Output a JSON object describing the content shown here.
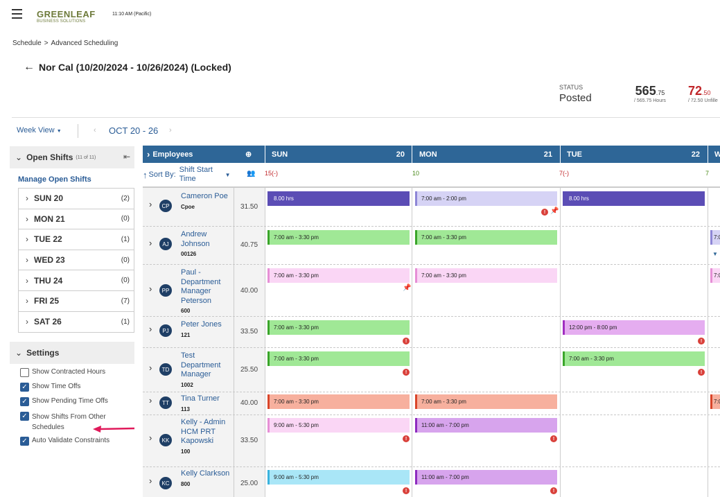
{
  "header": {
    "logo_main": "GREENLEAF",
    "logo_sub": "BUSINESS SOLUTIONS",
    "clock": "11:10 AM (Pacific)"
  },
  "breadcrumb": [
    "Schedule",
    ">",
    "Advanced Scheduling"
  ],
  "page_title": "Nor Cal (10/20/2024 - 10/26/2024) (Locked)",
  "status": {
    "label": "STATUS",
    "value": "Posted",
    "hours_main": "565",
    "hours_dec": ".75",
    "hours_sub": "/ 565.75 Hours",
    "unfilled_main": "72",
    "unfilled_dec": ".50",
    "unfilled_sub": "/ 72.50 Unfille"
  },
  "toolbar": {
    "week_view": "Week View",
    "date_range": "OCT 20 - 26"
  },
  "open_shifts": {
    "title": "Open Shifts",
    "count": "(11 of 11)",
    "manage_link": "Manage Open Shifts",
    "days": [
      {
        "label": "SUN 20",
        "count": "(2)"
      },
      {
        "label": "MON 21",
        "count": "(0)"
      },
      {
        "label": "TUE 22",
        "count": "(1)"
      },
      {
        "label": "WED 23",
        "count": "(0)"
      },
      {
        "label": "THU 24",
        "count": "(0)"
      },
      {
        "label": "FRI 25",
        "count": "(7)"
      },
      {
        "label": "SAT 26",
        "count": "(1)"
      }
    ]
  },
  "settings": {
    "title": "Settings",
    "items": [
      {
        "label": "Show Contracted Hours",
        "checked": false
      },
      {
        "label": "Show Time Offs",
        "checked": true
      },
      {
        "label": "Show Pending Time Offs",
        "checked": true
      },
      {
        "label": "Show Shifts From Other Schedules",
        "checked": true
      },
      {
        "label": "Auto Validate Constraints",
        "checked": true
      }
    ]
  },
  "grid": {
    "employees_label": "Employees",
    "sort_by": "Sort By:",
    "sort_field": "Shift Start Time",
    "days": [
      {
        "name": "SUN",
        "num": "20",
        "count": "15(-)",
        "count_color": "#c0262a"
      },
      {
        "name": "MON",
        "num": "21",
        "count": "10",
        "count_color": "#4a8a1a"
      },
      {
        "name": "TUE",
        "num": "22",
        "count": "7(-)",
        "count_color": "#c0262a"
      },
      {
        "name": "W",
        "num": "",
        "count": "7",
        "count_color": "#4a8a1a"
      }
    ]
  },
  "employees": [
    {
      "initials": "CP",
      "name": "Cameron Poe",
      "id": "Cpoe",
      "hours": "31.50"
    },
    {
      "initials": "AJ",
      "name": "Andrew Johnson",
      "id": "00126",
      "hours": "40.75"
    },
    {
      "initials": "PP",
      "name": "Paul - Department Manager Peterson",
      "id": "600",
      "hours": "40.00"
    },
    {
      "initials": "PJ",
      "name": "Peter Jones",
      "id": "121",
      "hours": "33.50"
    },
    {
      "initials": "TD",
      "name": "Test Department Manager",
      "id": "1002",
      "hours": "25.50"
    },
    {
      "initials": "TT",
      "name": "Tina Turner",
      "id": "113",
      "hours": "40.00"
    },
    {
      "initials": "KK",
      "name": "Kelly - Admin HCM PRT Kapowski",
      "id": "100",
      "hours": "33.50"
    },
    {
      "initials": "KC",
      "name": "Kelly Clarkson",
      "id": "800",
      "hours": "25.00"
    }
  ],
  "shifts": [
    {
      "label": "8.00 hrs",
      "bg": "#5b4db5",
      "border": "#5b4db5",
      "color": "#fff"
    },
    {
      "label": "7:00 am - 2:00 pm",
      "bg": "#d6d3f5",
      "border": "#8e86d6",
      "color": "#222"
    },
    {
      "label": "8.00 hrs",
      "bg": "#5b4db5",
      "border": "#5b4db5",
      "color": "#fff"
    },
    {
      "label": "7:00 am - 3:30 pm",
      "bg": "#a0e896",
      "border": "#3aa52a",
      "color": "#222"
    },
    {
      "label": "7:00 am - 3:30 pm",
      "bg": "#a0e896",
      "border": "#3aa52a",
      "color": "#222"
    },
    {
      "label": "7:0",
      "bg": "#d6d3f5",
      "border": "#8e86d6",
      "color": "#222"
    },
    {
      "label": "7:00 am - 3:30 pm",
      "bg": "#fad6f5",
      "border": "#e68fd6",
      "color": "#222"
    },
    {
      "label": "7:00 am - 3:30 pm",
      "bg": "#fad6f5",
      "border": "#e68fd6",
      "color": "#222"
    },
    {
      "label": "7:0",
      "bg": "#fad6f5",
      "border": "#e68fd6",
      "color": "#222"
    },
    {
      "label": "7:00 am - 3:30 pm",
      "bg": "#a0e896",
      "border": "#3aa52a",
      "color": "#222"
    },
    {
      "label": "12:00 pm - 8:00 pm",
      "bg": "#e5adf0",
      "border": "#a02cc0",
      "color": "#222"
    },
    {
      "label": "7:00 am - 3:30 pm",
      "bg": "#a0e896",
      "border": "#3aa52a",
      "color": "#222"
    },
    {
      "label": "7:00 am - 3:30 pm",
      "bg": "#a0e896",
      "border": "#3aa52a",
      "color": "#222"
    },
    {
      "label": "7:00 am - 3:30 pm",
      "bg": "#f7b09e",
      "border": "#d9452a",
      "color": "#222"
    },
    {
      "label": "7:00 am - 3:30 pm",
      "bg": "#f7b09e",
      "border": "#d9452a",
      "color": "#222"
    },
    {
      "label": "7:0",
      "bg": "#f7b09e",
      "border": "#d9452a",
      "color": "#222"
    },
    {
      "label": "9:00 am - 5:30 pm",
      "bg": "#fad6f5",
      "border": "#e68fd6",
      "color": "#222"
    },
    {
      "label": "11:00 am - 7:00 pm",
      "bg": "#d7a4ed",
      "border": "#8e2cbf",
      "color": "#222"
    },
    {
      "label": "9:00 am - 5:30 pm",
      "bg": "#a9e6f7",
      "border": "#3ab3de",
      "color": "#222"
    },
    {
      "label": "11:00 am - 7:00 pm",
      "bg": "#d7a4ed",
      "border": "#8e2cbf",
      "color": "#222"
    }
  ]
}
